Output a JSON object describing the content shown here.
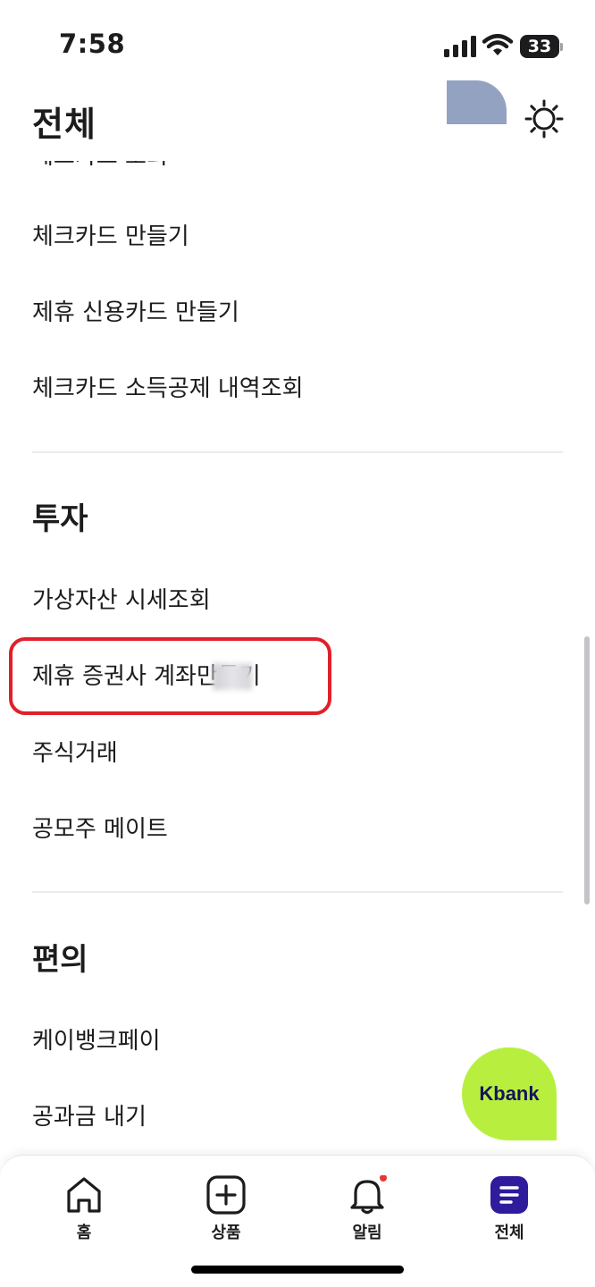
{
  "status_bar": {
    "time": "7:58",
    "battery": "33"
  },
  "header": {
    "title": "전체"
  },
  "menu": {
    "clipped_item": "체크카드 조회",
    "card_items": [
      "체크카드 만들기",
      "제휴 신용카드 만들기",
      "체크카드 소득공제 내역조회"
    ],
    "invest_section": "투자",
    "invest_items": [
      "가상자산 시세조회",
      "제휴 증권사 계좌만들기",
      "주식거래",
      "공모주 메이트"
    ],
    "convenience_section": "편의",
    "convenience_items": [
      "케이뱅크페이",
      "공과금 내기"
    ]
  },
  "fab": {
    "label": "Kbank",
    "color": "#b8ef3f"
  },
  "nav": {
    "items": [
      {
        "label": "홈",
        "icon": "home-icon"
      },
      {
        "label": "상품",
        "icon": "plus-square-icon"
      },
      {
        "label": "알림",
        "icon": "bell-icon"
      },
      {
        "label": "전체",
        "icon": "menu-icon"
      }
    ],
    "active_color": "#2f1c9c",
    "badge_color": "#e33"
  },
  "highlight_color": "#e0202a"
}
